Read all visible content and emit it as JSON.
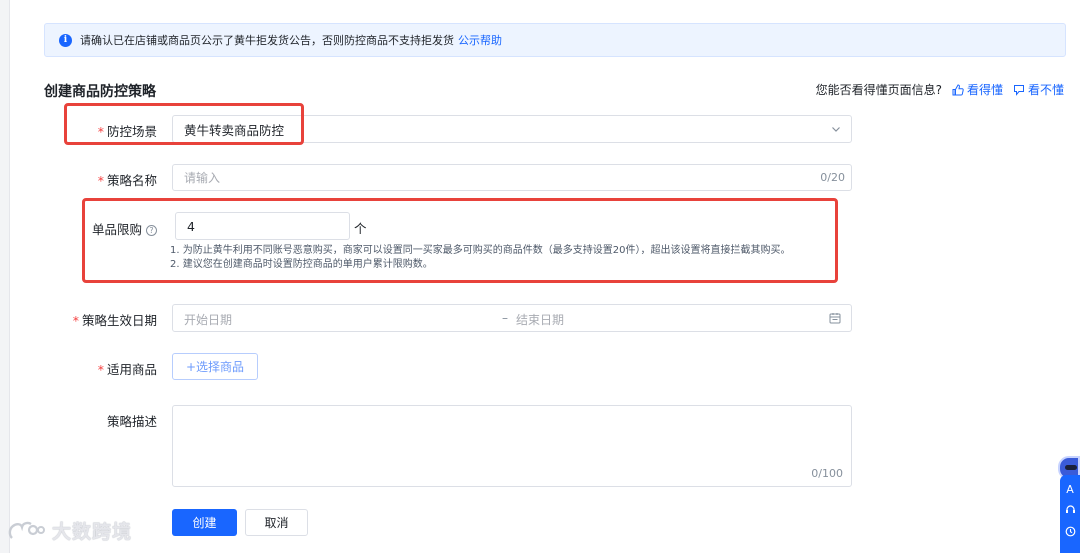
{
  "notice": {
    "text": "请确认已在店铺或商品页公示了黄牛拒发货公告，否则防控商品不支持拒发货",
    "link": "公示帮助"
  },
  "page": {
    "title": "创建商品防控策略"
  },
  "feedback": {
    "question": "您能否看得懂页面信息?",
    "yes": "看得懂",
    "no": "看不懂"
  },
  "form": {
    "scene": {
      "label": "防控场景",
      "value": "黄牛转卖商品防控"
    },
    "name": {
      "label": "策略名称",
      "placeholder": "请输入",
      "counter": "0/20"
    },
    "limit": {
      "label": "单品限购",
      "value": "4",
      "unit": "个",
      "tip1": "1. 为防止黄牛利用不同账号恶意购买，商家可以设置同一买家最多可购买的商品件数（最多支持设置20件），超出该设置将直接拦截其购买。",
      "tip2": "2. 建议您在创建商品时设置防控商品的单用户累计限购数。"
    },
    "date": {
      "label": "策略生效日期",
      "start_placeholder": "开始日期",
      "separator": "–",
      "end_placeholder": "结束日期"
    },
    "goods": {
      "label": "适用商品",
      "button": "+选择商品"
    },
    "desc": {
      "label": "策略描述",
      "counter": "0/100"
    }
  },
  "actions": {
    "create": "创建",
    "cancel": "取消"
  },
  "side": {
    "icon_text": "A"
  },
  "watermark": {
    "text": "大数跨境"
  },
  "colors": {
    "primary": "#1966ff",
    "required": "#f53f3f",
    "highlight_box": "#e8423b"
  }
}
